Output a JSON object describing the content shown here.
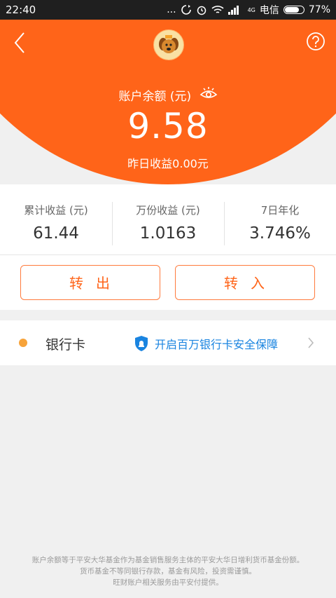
{
  "status_bar": {
    "time": "22:40",
    "dots": "...",
    "network": "4G",
    "carrier": "电信",
    "battery": "77%"
  },
  "header": {
    "balance_label": "账户余额 (元)",
    "balance_value": "9.58",
    "yesterday_earnings": "昨日收益0.00元",
    "accent_color": "#ff6419"
  },
  "stats": [
    {
      "label": "累计收益 (元)",
      "value": "61.44"
    },
    {
      "label": "万份收益 (元)",
      "value": "1.0163"
    },
    {
      "label": "7日年化",
      "value": "3.746%"
    }
  ],
  "actions": {
    "transfer_out": "转出",
    "transfer_in": "转入"
  },
  "bank": {
    "label": "银行卡",
    "security_text": "开启百万银行卡安全保障",
    "link_color": "#1a84e0"
  },
  "footer": {
    "line1": "账户余额等于平安大华基金作为基金销售服务主体的平安大华日增利货币基金份额。",
    "line2": "货币基金不等同银行存款，基金有风险，投资需谨慎。",
    "line3": "旺财账户相关服务由平安付提供。"
  },
  "icons": [
    "back-icon",
    "help-icon",
    "avatar",
    "eye-icon",
    "shield-icon",
    "chevron-right-icon"
  ]
}
